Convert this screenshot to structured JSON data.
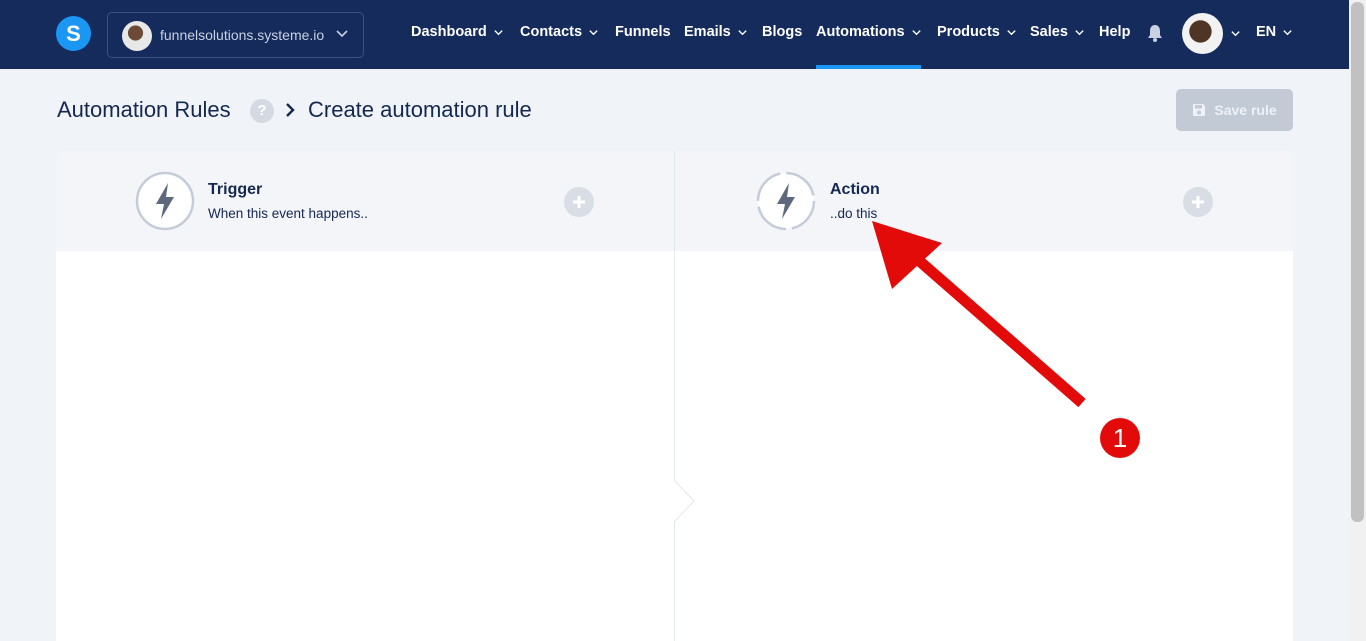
{
  "nav": {
    "site_name": "funnelsolutions.systeme.io",
    "items": [
      {
        "label": "Dashboard",
        "dropdown": true
      },
      {
        "label": "Contacts",
        "dropdown": true
      },
      {
        "label": "Funnels",
        "dropdown": false
      },
      {
        "label": "Emails",
        "dropdown": true
      },
      {
        "label": "Blogs",
        "dropdown": false
      },
      {
        "label": "Automations",
        "dropdown": true,
        "active": true
      },
      {
        "label": "Products",
        "dropdown": true
      },
      {
        "label": "Sales",
        "dropdown": true
      },
      {
        "label": "Help",
        "dropdown": false
      }
    ],
    "language": "EN",
    "accent_color": "#1a96f3",
    "background_color": "#142b5c"
  },
  "breadcrumb": {
    "root": "Automation Rules",
    "current": "Create automation rule",
    "help_icon": "?"
  },
  "toolbar": {
    "save_label": "Save rule",
    "save_icon": "floppy-disk-icon"
  },
  "trigger_panel": {
    "title": "Trigger",
    "subtitle": "When this event happens..",
    "icon": "lightning-bolt-icon"
  },
  "action_panel": {
    "title": "Action",
    "subtitle": "..do this",
    "icon": "lightning-bolt-refresh-icon"
  },
  "annotation": {
    "marker_label": "1",
    "color": "#e30a0a"
  }
}
